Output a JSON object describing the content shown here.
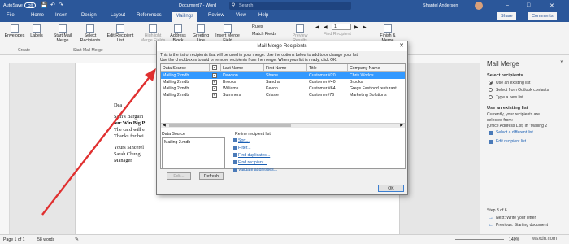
{
  "titlebar": {
    "autosave": "AutoSave",
    "toggle": "Off",
    "document": "Document7 - Word",
    "search_placeholder": "Search",
    "user": "Shantel Anderson",
    "share": "Share",
    "comments": "Comments"
  },
  "tabs": [
    "File",
    "Home",
    "Insert",
    "Design",
    "Layout",
    "References",
    "Mailings",
    "Review",
    "View",
    "Help"
  ],
  "active_tab": "Mailings",
  "ribbon": {
    "buttons": [
      "Envelopes",
      "Labels",
      "Start Mail Merge",
      "Select Recipients",
      "Edit Recipient List",
      "Highlight Merge Fields",
      "Address Block",
      "Greeting Line",
      "Insert Merge Field",
      "Rules",
      "Match Fields",
      "Preview Results",
      "Find Recipient",
      "Finish & Merge"
    ],
    "groups": [
      "Create",
      "Start Mail Merge"
    ],
    "record": "1"
  },
  "document": {
    "lines": [
      "Dea",
      "Sam's Bargain",
      "our Win Big P",
      "The card will e",
      "Thanks for bei",
      "Yours Sincerel",
      "Sarah Chung",
      " Manager"
    ]
  },
  "dialog": {
    "title": "Mail Merge Recipients",
    "close": "✕",
    "instructions": [
      "This is the list of recipients that will be used in your merge. Use the options below to add to or change your list.",
      "Use the checkboxes to add or remove recipients from the merge. When your list is ready, click OK."
    ],
    "columns": [
      "Data Source",
      "",
      "Last Name",
      "First Name",
      "Title",
      "Company Name"
    ],
    "rows": [
      {
        "source": "Mailing 2.mdb",
        "last": "Dawson",
        "first": "Shane",
        "title": "Customer #20",
        "company": "Chris Worlds"
      },
      {
        "source": "Mailing 2.mdb",
        "last": "Brooks",
        "first": "Sandra",
        "title": "Customer #40",
        "company": "Brooks"
      },
      {
        "source": "Mailing 2.mdb",
        "last": "Williams",
        "first": "Kevon",
        "title": "Customer #64",
        "company": "Gregs Fastfood resturant"
      },
      {
        "source": "Mailing 2.mdb",
        "last": "Summers",
        "first": "Crissie",
        "title": "Customer#76",
        "company": "Marketing Solutions"
      }
    ],
    "data_source_label": "Data Source",
    "data_source_item": "Mailing 2.mdb",
    "refine_label": "Refine recipient list",
    "refine_links": [
      "Sort...",
      "Filter...",
      "Find duplicates...",
      "Find recipient...",
      "Validate addresses..."
    ],
    "edit_button": "Edit...",
    "refresh_button": "Refresh",
    "ok_button": "OK"
  },
  "pane": {
    "title": "Mail Merge",
    "close": "×",
    "select_heading": "Select recipients",
    "options": [
      "Use an existing list",
      "Select from Outlook contacts",
      "Type a new list"
    ],
    "existing_heading": "Use an existing list",
    "existing_text": [
      "Currently, your recipients are",
      "selected from:",
      "[Office Address List] in \"Mailing 2"
    ],
    "links": [
      "Select a different list...",
      "Edit recipient list..."
    ],
    "step": "Step 3 of 6",
    "next": "Next: Write your letter",
    "previous": "Previous: Starting document"
  },
  "status": {
    "page": "Page 1 of 1",
    "words": "58 words",
    "zoom": "140%"
  },
  "watermark": "wsxdn.com",
  "colors": {
    "word_blue": "#2b579a",
    "selection": "#3399ff",
    "arrow": "#e03030"
  }
}
